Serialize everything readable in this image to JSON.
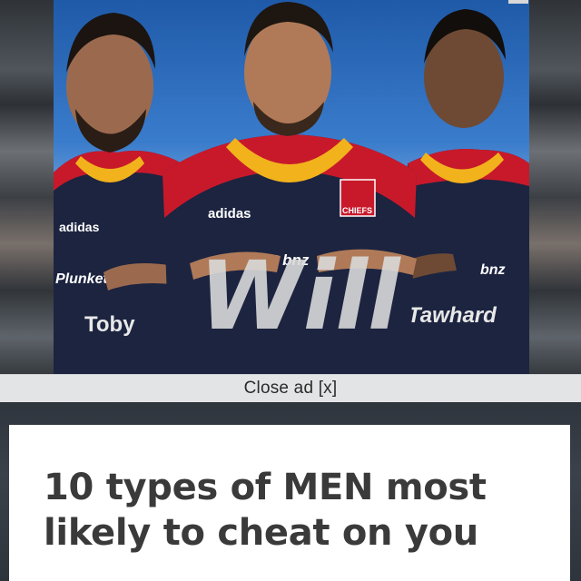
{
  "ad": {
    "overlay_text": "Will",
    "players": [
      {
        "shirt_brand": "adidas",
        "sponsor": "Plunket",
        "name_on_shirt": "Toby"
      },
      {
        "shirt_brand": "adidas",
        "sponsor": "Plunket bnz",
        "crest": "CHIEFS"
      },
      {
        "sponsor": "bnz",
        "name_on_shirt": "Tawhard"
      }
    ],
    "close_label": "Close ad [x]"
  },
  "article": {
    "title": "10 types of MEN most likely to cheat on you"
  },
  "colors": {
    "sky": "#2e6fbf",
    "jersey_navy": "#1c2440",
    "jersey_red": "#c8192b",
    "jersey_yellow": "#f2b21c",
    "close_bar": "#e3e4e6",
    "title_text": "#3a3a3a",
    "card": "#ffffff"
  }
}
